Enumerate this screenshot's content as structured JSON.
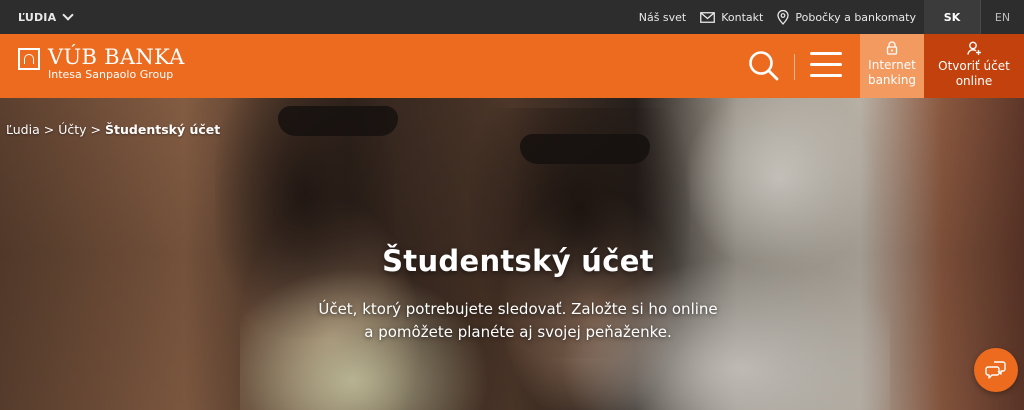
{
  "topbar": {
    "segment_label": "ĽUDIA",
    "links": {
      "nas_svet": "Náš svet",
      "kontakt": "Kontakt",
      "pobocky": "Pobočky a bankomaty"
    },
    "lang_active": "SK",
    "lang_other": "EN"
  },
  "header": {
    "logo_name": "VÚB BANKA",
    "logo_sub": "Intesa Sanpaolo Group",
    "internet_banking": [
      "Internet",
      "banking"
    ],
    "open_account": [
      "Otvoriť účet",
      "online"
    ]
  },
  "breadcrumb": {
    "items": [
      "Ľudia",
      "Účty"
    ],
    "separator": ">",
    "current": "Študentský účet"
  },
  "hero": {
    "title": "Študentský účet",
    "subtitle_line1": "Účet, ktorý potrebujete sledovať. Založte si ho online",
    "subtitle_line2": "a pomôžete planéte aj svojej peňaženke."
  },
  "icons": {
    "segment": "chevron-down-icon",
    "kontakt": "mail-icon",
    "pobocky": "map-pin-icon",
    "search": "search-icon",
    "menu": "hamburger-menu-icon",
    "internet_banking": "lock-icon",
    "open_account": "user-add-icon",
    "chat": "chat-icon"
  },
  "colors": {
    "brand_orange": "#ed6b1e",
    "ib_orange_light": "#f29a60",
    "open_orange_dark": "#c2410c",
    "topbar": "#2d2d2d"
  }
}
